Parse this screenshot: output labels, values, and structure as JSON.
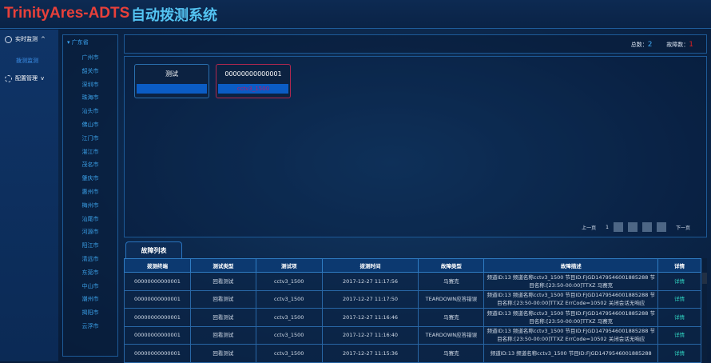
{
  "header": {
    "brand": "TrinityAres-ADTS",
    "title": "自动拨测系统"
  },
  "sidebar": {
    "menu": [
      {
        "label": "实时监测",
        "icon": "monitor-icon",
        "chevron": "^",
        "sub": "拨测监测"
      },
      {
        "label": "配置管理",
        "icon": "gear-icon",
        "chevron": "v"
      }
    ]
  },
  "tree": {
    "root": "广东省",
    "cities": [
      "广州市",
      "韶关市",
      "深圳市",
      "珠海市",
      "汕头市",
      "佛山市",
      "江门市",
      "湛江市",
      "茂名市",
      "肇庆市",
      "惠州市",
      "梅州市",
      "汕尾市",
      "河源市",
      "阳江市",
      "清远市",
      "东莞市",
      "中山市",
      "潮州市",
      "揭阳市",
      "云浮市"
    ]
  },
  "stats": {
    "total_label": "总数：",
    "total": "2",
    "fault_label": "故障数：",
    "fault": "1"
  },
  "cards": [
    {
      "title": "测试",
      "sub": ""
    },
    {
      "title": "00000000000001",
      "sub": "cctv3_1500"
    }
  ],
  "pager": {
    "prev": "上一页",
    "page": "1",
    "next": "下一页"
  },
  "fault_list": {
    "tab": "故障列表",
    "columns": [
      "拨测终端",
      "测试类型",
      "测试项",
      "拨测时间",
      "故障类型",
      "故障描述",
      "详情"
    ],
    "rows": [
      [
        "00000000000001",
        "回看测试",
        "cctv3_1500",
        "2017-12-27 11:17:56",
        "马赛克",
        "频道ID:13 频道名称cctv3_1500 节目ID:FJGD1479546001885288 节目名称:[23:50-00:00]TTXZ 马赛克",
        "详情"
      ],
      [
        "00000000000001",
        "回看测试",
        "cctv3_1500",
        "2017-12-27 11:17:50",
        "TEARDOWN应答错误",
        "频道ID:13 频道名称cctv3_1500 节目ID:FJGD1479546001885288 节目名称:[23:50-00:00]TTXZ ErrCode=10502 关闭会话无响应",
        "详情"
      ],
      [
        "00000000000001",
        "回看测试",
        "cctv3_1500",
        "2017-12-27 11:16:46",
        "马赛克",
        "频道ID:13 频道名称cctv3_1500 节目ID:FJGD1479546001885288 节目名称:[23:50-00:00]TTXZ 马赛克",
        "详情"
      ],
      [
        "00000000000001",
        "回看测试",
        "cctv3_1500",
        "2017-12-27 11:16:40",
        "TEARDOWN应答错误",
        "频道ID:13 频道名称cctv3_1500 节目ID:FJGD1479546001885288 节目名称:[23:50-00:00]TTXZ ErrCode=10502 关闭会话无响应",
        "详情"
      ],
      [
        "00000000000001",
        "回看测试",
        "cctv3_1500",
        "2017-12-27 11:15:36",
        "马赛克",
        "频道ID:13 频道名称cctv3_1500 节目ID:FJGD1479546001885288",
        "详情"
      ]
    ]
  },
  "colors": {
    "brand": "#e8403a",
    "title": "#54c4f2",
    "total": "#3fa9f5",
    "fault": "#e02020",
    "card_alert": "#b4196e"
  }
}
